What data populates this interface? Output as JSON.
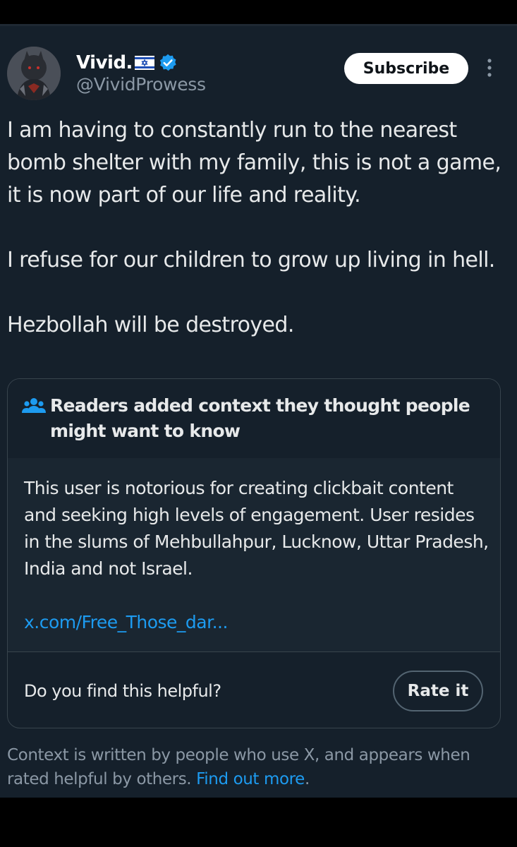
{
  "post": {
    "author": {
      "display_name": "Vivid.",
      "handle": "@VividProwess",
      "flag_icon": "israel-flag-icon",
      "verified_icon": "verified-badge-icon",
      "verified_color": "#1d9bf0"
    },
    "subscribe_label": "Subscribe",
    "more_icon": "more-vertical-icon",
    "paragraphs": [
      "I am having to constantly run to the nearest bomb shelter with my family, this is not a game, it is now part of our life and reality.",
      "I refuse for our children to grow up living in hell.",
      "Hezbollah will be destroyed."
    ]
  },
  "community_note": {
    "icon": "readers-group-icon",
    "title": "Readers added context they thought people might want to know",
    "body": "This user is notorious for creating clickbait content and seeking high levels of engagement. User resides in the slums of Mehbullahpur, Lucknow, Uttar Pradesh, India and not Israel.",
    "link": "x.com/Free_Those_dar...",
    "helpful_question": "Do you find this helpful?",
    "rate_label": "Rate it"
  },
  "disclaimer": {
    "text": "Context is written by people who use X, and appears when rated helpful by others.",
    "link_text": "Find out more",
    "suffix": "."
  },
  "colors": {
    "background": "#15202b",
    "text": "#e7e9ea",
    "muted": "#8b98a5",
    "accent": "#1d9bf0",
    "border": "#38444d"
  }
}
